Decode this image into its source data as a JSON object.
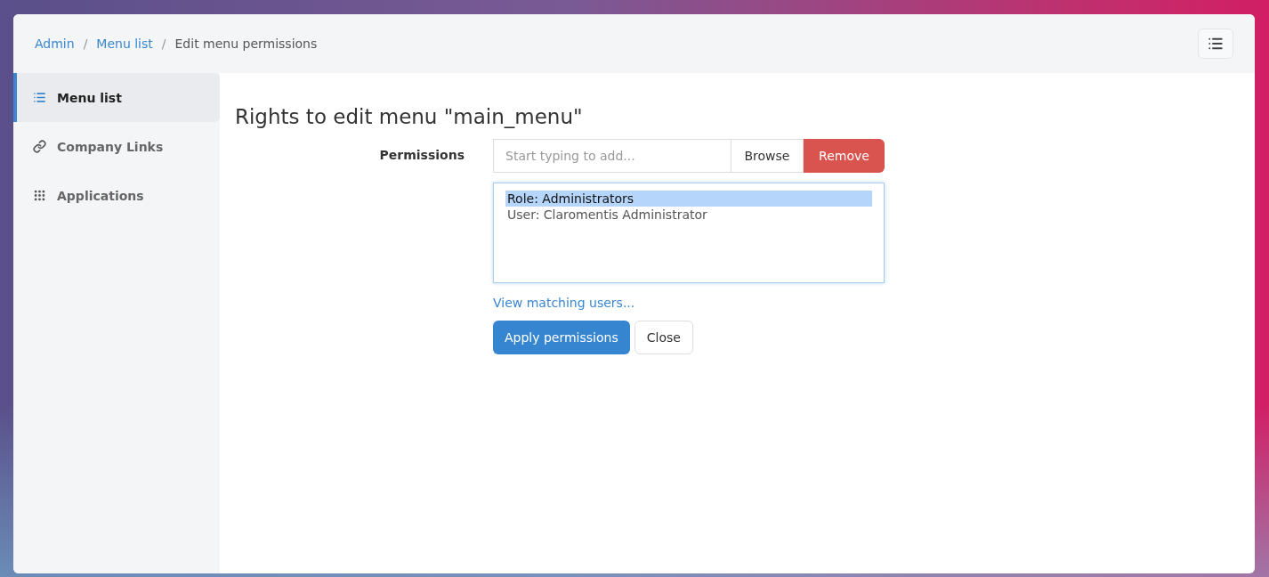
{
  "breadcrumb": [
    {
      "label": "Admin",
      "kind": "link"
    },
    {
      "separator": "/",
      "label": "Menu list",
      "kind": "link"
    },
    {
      "separator": "/",
      "label": "Edit menu permissions",
      "kind": "current"
    }
  ],
  "sidebar": {
    "items": [
      {
        "label": "Menu list",
        "kind": "list",
        "selected": true
      },
      {
        "label": "Company Links",
        "kind": "link",
        "selected": false
      },
      {
        "label": "Applications",
        "kind": "grid",
        "selected": false
      }
    ]
  },
  "title": "Rights to edit menu \"main_menu\"",
  "permissions": {
    "label": "Permissions",
    "placeholder": "Start typing to add...",
    "browse": "Browse",
    "remove": "Remove",
    "entries": [
      {
        "label": "Role: Administrators",
        "selected": true
      },
      {
        "label": "User: Claromentis Administrator",
        "selected": false
      }
    ],
    "link": "View matching users...",
    "apply": "Apply permissions",
    "close": "Close"
  }
}
